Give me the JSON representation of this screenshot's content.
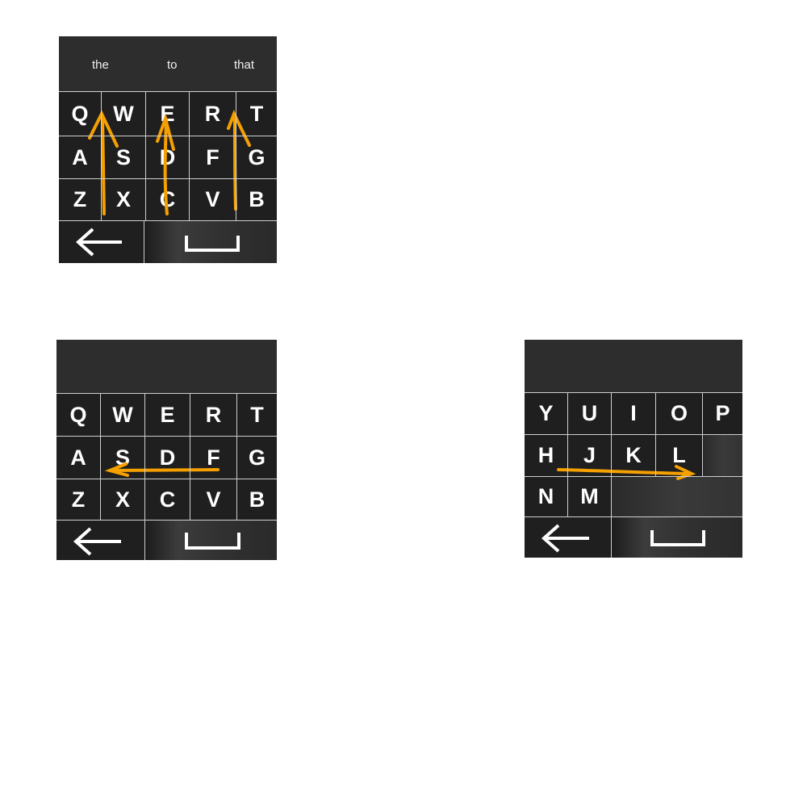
{
  "colors": {
    "keyboard_bg": "#2a2a2a",
    "key_text": "#ffffff",
    "gesture": "#f5a000",
    "divider": "#cfcfcf"
  },
  "keyboard_a": {
    "suggestions": [
      "the",
      "to",
      "that"
    ],
    "rows": [
      [
        "Q",
        "W",
        "E",
        "R",
        "T"
      ],
      [
        "A",
        "S",
        "D",
        "F",
        "G"
      ],
      [
        "Z",
        "X",
        "C",
        "V",
        "B"
      ]
    ],
    "backspace_icon": "left-arrow-icon",
    "space_icon": "space-bracket-icon",
    "gesture": "three upward swipe arrows"
  },
  "keyboard_b": {
    "rows": [
      [
        "Q",
        "W",
        "E",
        "R",
        "T"
      ],
      [
        "A",
        "S",
        "D",
        "F",
        "G"
      ],
      [
        "Z",
        "X",
        "C",
        "V",
        "B"
      ]
    ],
    "backspace_icon": "left-arrow-icon",
    "space_icon": "space-bracket-icon",
    "gesture": "leftward swipe arrow"
  },
  "keyboard_c": {
    "rows": [
      [
        "Y",
        "U",
        "I",
        "O",
        "P"
      ],
      [
        "H",
        "J",
        "K",
        "L"
      ],
      [
        "N",
        "M"
      ]
    ],
    "backspace_icon": "left-arrow-icon",
    "space_icon": "space-bracket-icon",
    "gesture": "rightward swipe arrow"
  }
}
